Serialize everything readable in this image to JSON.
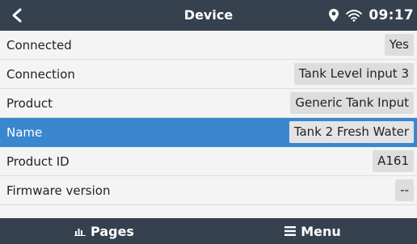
{
  "header": {
    "back_icon": "chevron-left-icon",
    "title": "Device",
    "location_icon": "location-pin-icon",
    "wifi_icon": "wifi-icon",
    "time": "09:17"
  },
  "rows": [
    {
      "label": "Connected",
      "value": "Yes"
    },
    {
      "label": "Connection",
      "value": "Tank Level input 3"
    },
    {
      "label": "Product",
      "value": "Generic Tank Input"
    },
    {
      "label": "Name",
      "value": "Tank 2 Fresh Water"
    },
    {
      "label": "Product ID",
      "value": "A161"
    },
    {
      "label": "Firmware version",
      "value": "--"
    }
  ],
  "selected_row": "Name",
  "footer": {
    "pages_label": "Pages",
    "pages_icon": "bar-chart-icon",
    "menu_label": "Menu",
    "menu_icon": "hamburger-menu-icon"
  },
  "colors": {
    "header_bg": "#35414f",
    "selected_bg": "#3a87d0",
    "background": "#f4f4f4"
  }
}
